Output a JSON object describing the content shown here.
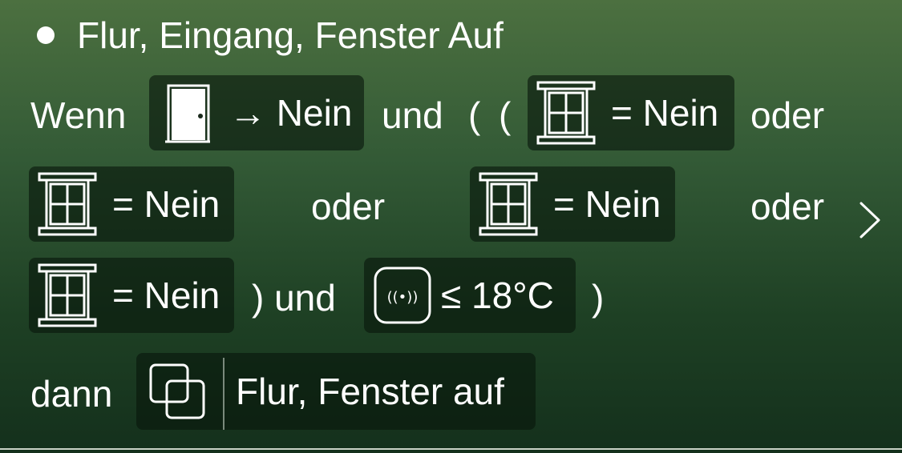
{
  "automation": {
    "title": "Flur, Eingang, Fenster Auf"
  },
  "condition": {
    "when_label": "Wenn",
    "door_chip": {
      "icon": "door-icon",
      "label": "→ Nein"
    },
    "and_label_1": "und",
    "open_paren_1": "(",
    "open_paren_2": "(",
    "window_chip_1": {
      "icon": "window-icon",
      "label": "= Nein"
    },
    "or_label_1": "oder",
    "window_chip_2": {
      "icon": "window-icon",
      "label": "= Nein"
    },
    "or_label_2": "oder",
    "window_chip_3": {
      "icon": "window-icon",
      "label": "= Nein"
    },
    "or_label_3": "oder",
    "window_chip_4": {
      "icon": "window-icon",
      "label": "= Nein"
    },
    "close_paren_and": ") und",
    "sensor_chip": {
      "icon": "sensor-icon",
      "label": "≤ 18°C"
    },
    "close_paren_2": ")"
  },
  "action": {
    "then_label": "dann",
    "scene_chip": {
      "icon": "scene-icon",
      "label": "Flur, Fenster auf"
    }
  },
  "navigation": {
    "chevron": "chevron-right-icon"
  }
}
